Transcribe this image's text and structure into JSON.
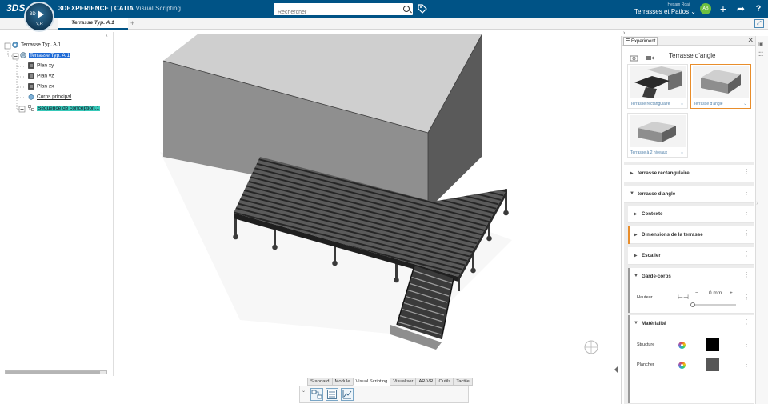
{
  "topbar": {
    "ds_logo": "3DS",
    "compass_3d": "3D",
    "compass_version": "V,R",
    "brand_3dexp": "3DEXPERIENCE",
    "brand_sep": " | ",
    "brand_catia": "CATIA",
    "brand_app": " Visual Scripting",
    "search_placeholder": "Rechercher",
    "user_name": "Hexam Rdai",
    "collab_space": "Terrasses et Patios ⌄",
    "avatar_initials": "AB",
    "add_icon": "+",
    "share_icon": "➦",
    "help_icon": "?"
  },
  "tabs": {
    "document": "Terrasse Typ. A.1",
    "add": "+"
  },
  "tree": {
    "root": "Terrasse Typ. A.1",
    "product": "Terrasse Typ. A.1",
    "items": [
      "Plan xy",
      "Plan yz",
      "Plan zx",
      "Corps principal",
      "Séquence de conception.1"
    ]
  },
  "action_tabs": [
    "Standard",
    "Module",
    "Visual Scripting",
    "Visualiser",
    "AR-VR",
    "Outils",
    "Tactile"
  ],
  "action_tabs_active": "Visual Scripting",
  "panel": {
    "tab_title": "Experiment",
    "close": "✕",
    "template_name": "Terrasse d'angle",
    "thumbs": [
      {
        "caption": "Terrasse rectangulaire"
      },
      {
        "caption": "Terrasse d'angle"
      },
      {
        "caption": "Terrasse à 2 niveaux"
      }
    ],
    "sections": {
      "terrasse_rect": "terrasse rectangulaire",
      "terrasse_angle": "terrasse d'angle",
      "contexte": "Contexte",
      "dimensions": "Dimensions de la terrasse",
      "escalier": "Escalier",
      "garde_corps": "Garde-corps",
      "hauteur_label": "Hauteur",
      "hauteur_value": "0 mm",
      "minus": "−",
      "plus": "+",
      "materialite": "Matérialité",
      "structure_label": "Structure",
      "plancher_label": "Plancher"
    },
    "hauteur_slider_fraction": 0.0
  },
  "colors": {
    "topbar": "#005386",
    "selection": "#1f6bd6",
    "sequence_highlight": "#37c9b9",
    "accent_orange": "#e88d2b",
    "structure_swatch": "#000000",
    "plancher_swatch": "#575757"
  },
  "icons": {
    "search": "search-icon",
    "tag": "tag-icon",
    "camera": "camera-icon",
    "video": "video-icon",
    "compass": "compass-icon",
    "color_wheel": "color-wheel-icon",
    "kebab": "kebab-icon"
  }
}
